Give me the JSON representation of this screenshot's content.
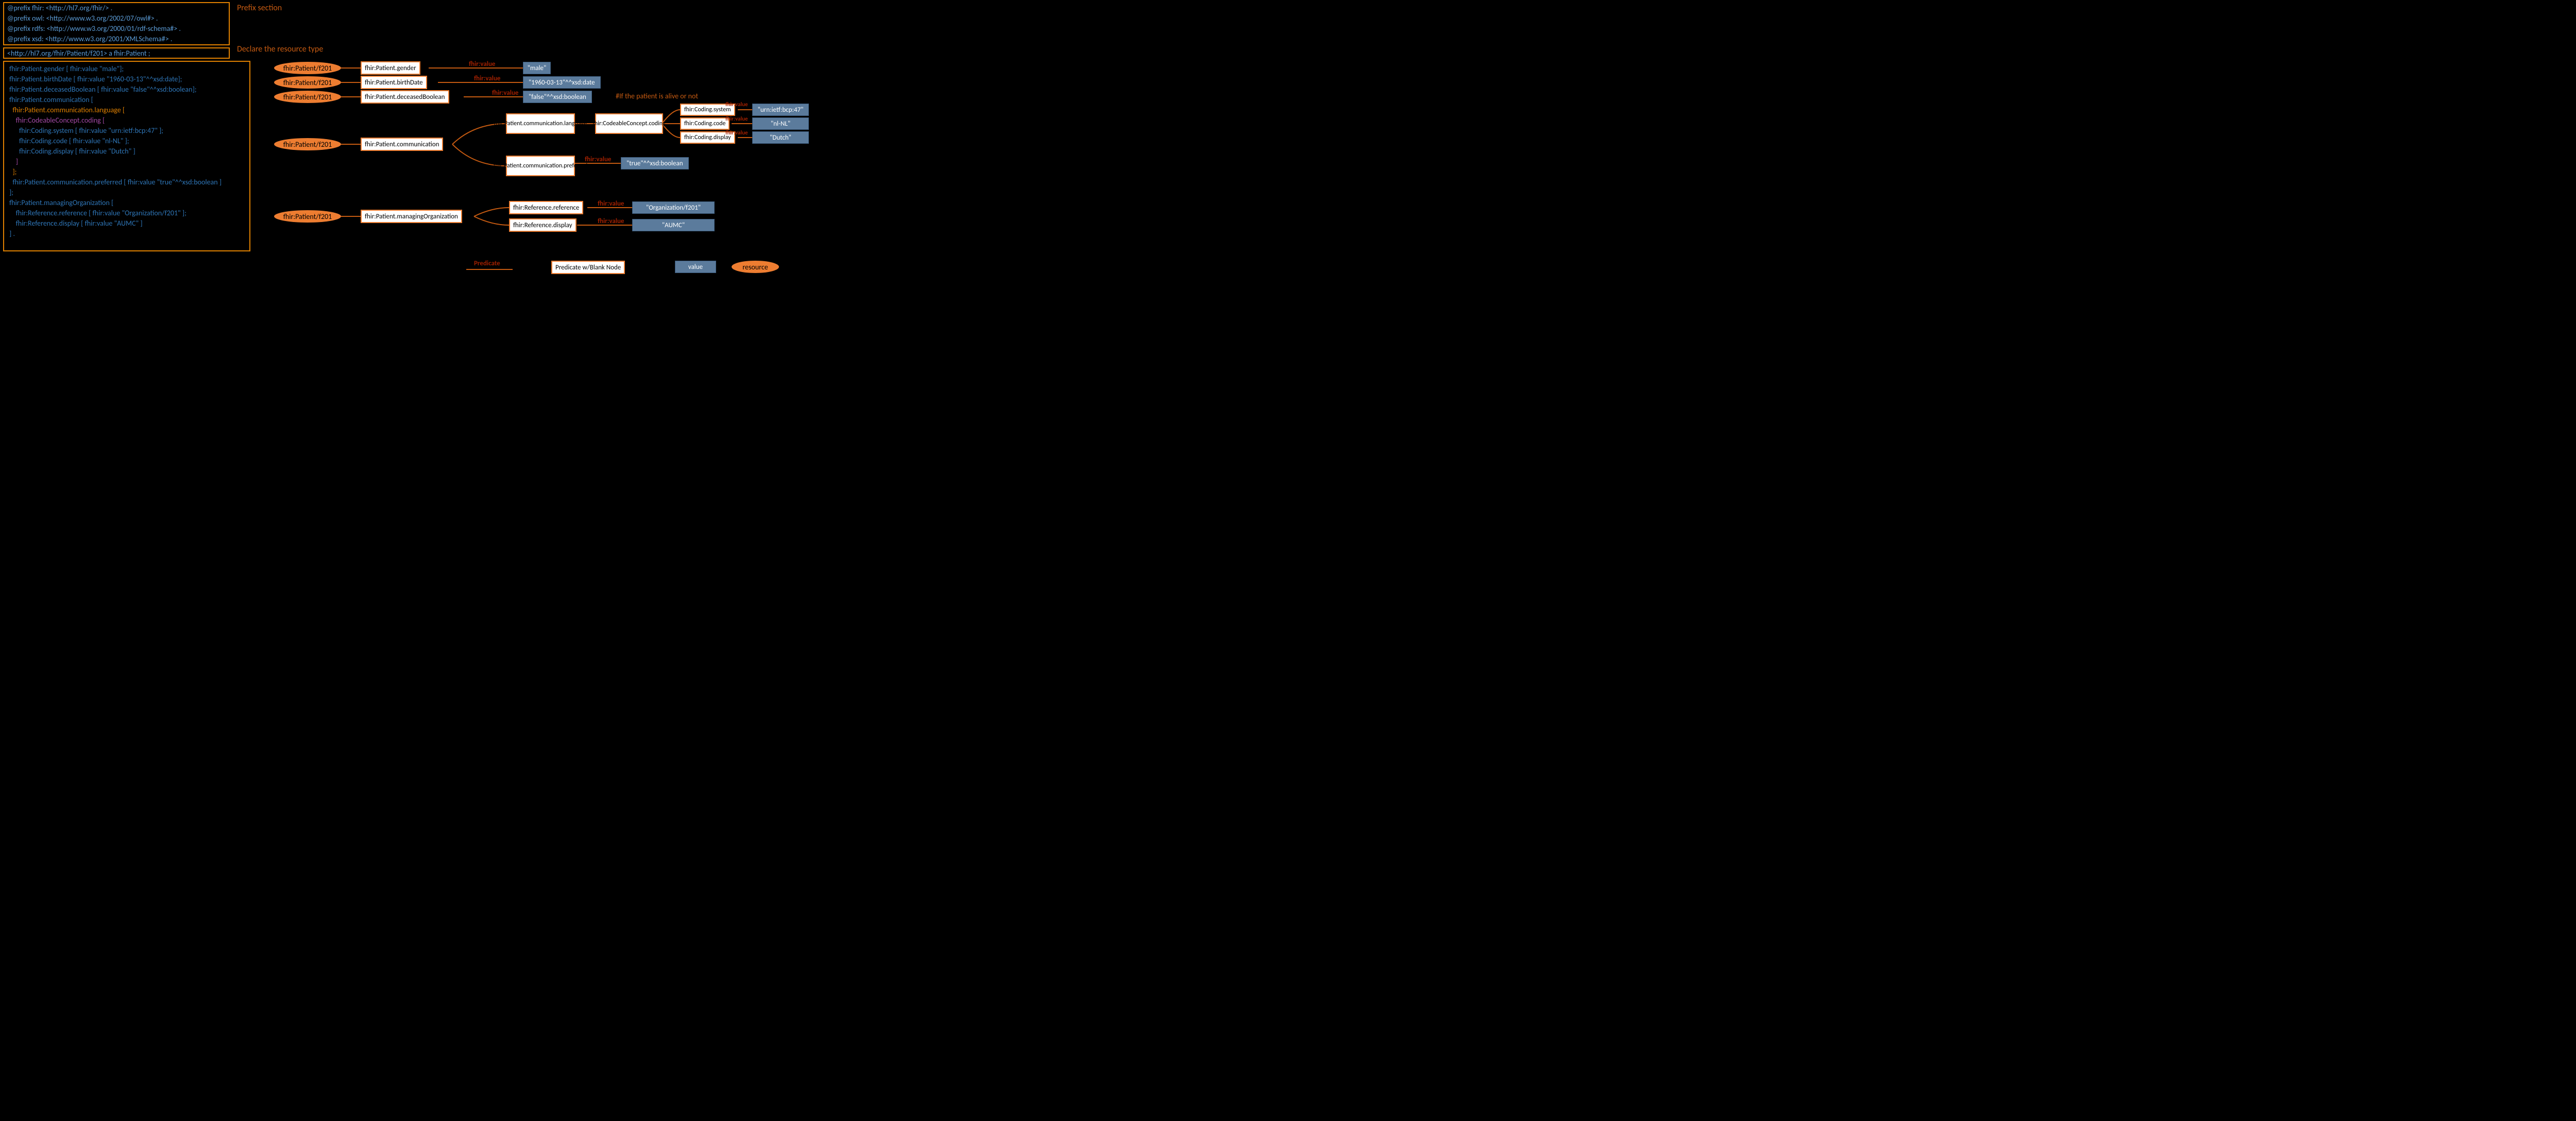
{
  "annotations": {
    "prefix_section": "Prefix section",
    "declare_type": "Declare the resource type",
    "alive_comment": "#If the patient is alive or not"
  },
  "code": {
    "prefix1": "@prefix fhir: <http://hl7.org/fhir/> .",
    "prefix2": "@prefix owl: <http://www.w3.org/2002/07/owl#> .",
    "prefix3": "@prefix rdfs: <http://www.w3.org/2000/01/rdf-schema#> .",
    "prefix4": "@prefix xsd: <http://www.w3.org/2001/XMLSchema#> .",
    "declare": "<http://hl7.org/fhir/Patient/f201> a fhir:Patient ;",
    "l1": "fhir:Patient.gender [ fhir:value \"male\"];",
    "l2": "fhir:Patient.birthDate [ fhir:value \"1960-03-13\"^^xsd:date];",
    "l3": "fhir:Patient.deceasedBoolean [ fhir:value \"false\"^^xsd:boolean];",
    "l4": "fhir:Patient.communication [",
    "l5": "  fhir:Patient.communication.language [",
    "l6": "    fhir:CodeableConcept.coding [",
    "l7": "      fhir:Coding.system [ fhir:value \"urn:ietf:bcp:47\" ];",
    "l8": "      fhir:Coding.code [ fhir:value \"nl-NL\" ];",
    "l9": "      fhir:Coding.display [ fhir:value \"Dutch\" ]",
    "l10": "    ]",
    "l11": "  ];",
    "l12": "  fhir:Patient.communication.preferred [ fhir:value \"true\"^^xsd:boolean ]",
    "l13": "];",
    "l14": "fhir:Patient.managingOrganization [",
    "l15": "    fhir:Reference.reference [ fhir:value \"Organization/f201\" ];",
    "l16": "    fhir:Reference.display [ fhir:value \"AUMC\" ]",
    "l17": "] ."
  },
  "diagram": {
    "resource_label": "fhir:Patient/f201",
    "fhir_value": "fhir:value",
    "gender": {
      "pred": "fhir:Patient.gender",
      "val": "\"male\""
    },
    "birthdate": {
      "pred": "fhir:Patient.birthDate",
      "val": "\"1960-03-13\"^^xsd:date"
    },
    "deceased": {
      "pred": "fhir:Patient.deceasedBoolean",
      "val": "\"false\"^^xsd:boolean"
    },
    "comm": "fhir:Patient.communication",
    "comm_lang": "fhir:Patient.communication.language",
    "comm_pref": "fhir:Patient.communication.preferred",
    "codeable": "fhir:CodeableConcept.coding",
    "coding_system": {
      "pred": "fhir:Coding.system",
      "val": "\"urn:ietf:bcp:47\""
    },
    "coding_code": {
      "pred": "fhir:Coding.code",
      "val": "\"nl-NL\""
    },
    "coding_display": {
      "pred": "fhir:Coding.display",
      "val": "\"Dutch\""
    },
    "pref_val": "\"true\"^^xsd:boolean",
    "man_org": "fhir:Patient.managingOrganization",
    "ref_ref": {
      "pred": "fhir:Reference.reference",
      "val": "\"Organization/f201\""
    },
    "ref_disp": {
      "pred": "fhir:Reference.display",
      "val": "\"AUMC\""
    }
  },
  "legend": {
    "predicate": "Predicate",
    "pred_blank": "Predicate w/Blank Node",
    "value": "value",
    "resource": "resource"
  }
}
